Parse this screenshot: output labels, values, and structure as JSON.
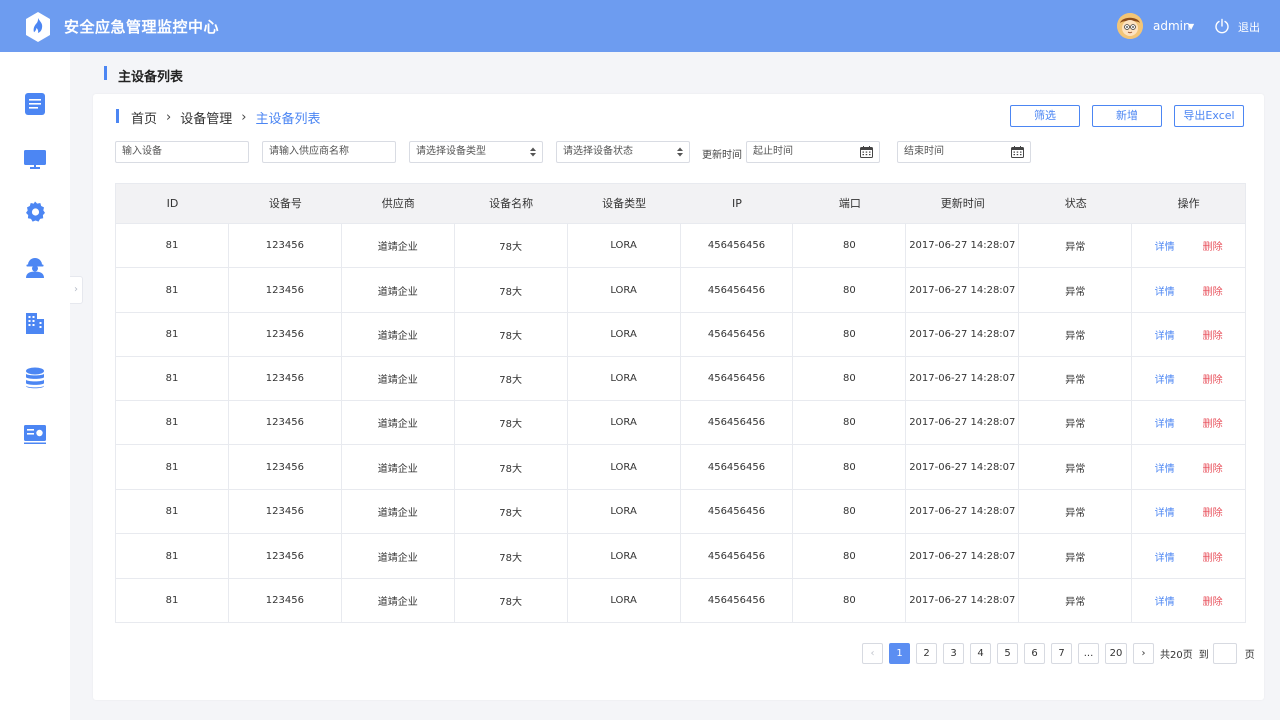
{
  "header": {
    "title": "安全应急管理监控中心",
    "user": "admin",
    "logout": "退出"
  },
  "sidebar": {
    "items": [
      {
        "icon": "document-list-icon"
      },
      {
        "icon": "monitor-icon"
      },
      {
        "icon": "settings-gear-icon"
      },
      {
        "icon": "worker-helmet-icon"
      },
      {
        "icon": "building-icon"
      },
      {
        "icon": "database-icon"
      },
      {
        "icon": "id-card-icon"
      }
    ],
    "collapse": "›"
  },
  "page": {
    "title": "主设备列表"
  },
  "breadcrumb": {
    "items": [
      "首页",
      "设备管理",
      "主设备列表"
    ],
    "sep": "›"
  },
  "toolbar": {
    "filter_label": "筛选",
    "add_label": "新增",
    "export_label": "导出Excel"
  },
  "filters": {
    "device": "输入设备",
    "supplier": "请输入供应商名称",
    "device_type": "请选择设备类型",
    "device_status": "请选择设备状态",
    "update_time_label": "更新时间",
    "start_time": "起止时间",
    "end_time": "结束时间"
  },
  "table": {
    "headers": [
      "ID",
      "设备号",
      "供应商",
      "设备名称",
      "设备类型",
      "IP",
      "端口",
      "更新时间",
      "状态",
      "操作"
    ],
    "detail_label": "详情",
    "delete_label": "删除",
    "rows": [
      [
        "81",
        "123456",
        "道靖企业",
        "78大",
        "LORA",
        "456456456",
        "80",
        "2017-06-27 14:28:07",
        "异常"
      ],
      [
        "81",
        "123456",
        "道靖企业",
        "78大",
        "LORA",
        "456456456",
        "80",
        "2017-06-27 14:28:07",
        "异常"
      ],
      [
        "81",
        "123456",
        "道靖企业",
        "78大",
        "LORA",
        "456456456",
        "80",
        "2017-06-27 14:28:07",
        "异常"
      ],
      [
        "81",
        "123456",
        "道靖企业",
        "78大",
        "LORA",
        "456456456",
        "80",
        "2017-06-27 14:28:07",
        "异常"
      ],
      [
        "81",
        "123456",
        "道靖企业",
        "78大",
        "LORA",
        "456456456",
        "80",
        "2017-06-27 14:28:07",
        "异常"
      ],
      [
        "81",
        "123456",
        "道靖企业",
        "78大",
        "LORA",
        "456456456",
        "80",
        "2017-06-27 14:28:07",
        "异常"
      ],
      [
        "81",
        "123456",
        "道靖企业",
        "78大",
        "LORA",
        "456456456",
        "80",
        "2017-06-27 14:28:07",
        "异常"
      ],
      [
        "81",
        "123456",
        "道靖企业",
        "78大",
        "LORA",
        "456456456",
        "80",
        "2017-06-27 14:28:07",
        "异常"
      ],
      [
        "81",
        "123456",
        "道靖企业",
        "78大",
        "LORA",
        "456456456",
        "80",
        "2017-06-27 14:28:07",
        "异常"
      ]
    ]
  },
  "pagination": {
    "prev": "‹",
    "next": "›",
    "pages": [
      "1",
      "2",
      "3",
      "4",
      "5",
      "6",
      "7",
      "...",
      "20"
    ],
    "current": "1",
    "total_text": "共20页",
    "goto_text": "到",
    "page_unit": "页"
  },
  "colors": {
    "header_bg": "#6d9cf0",
    "accent": "#4c86f3",
    "danger": "#e8505b",
    "sidebar_icon": "#4c86f3"
  }
}
